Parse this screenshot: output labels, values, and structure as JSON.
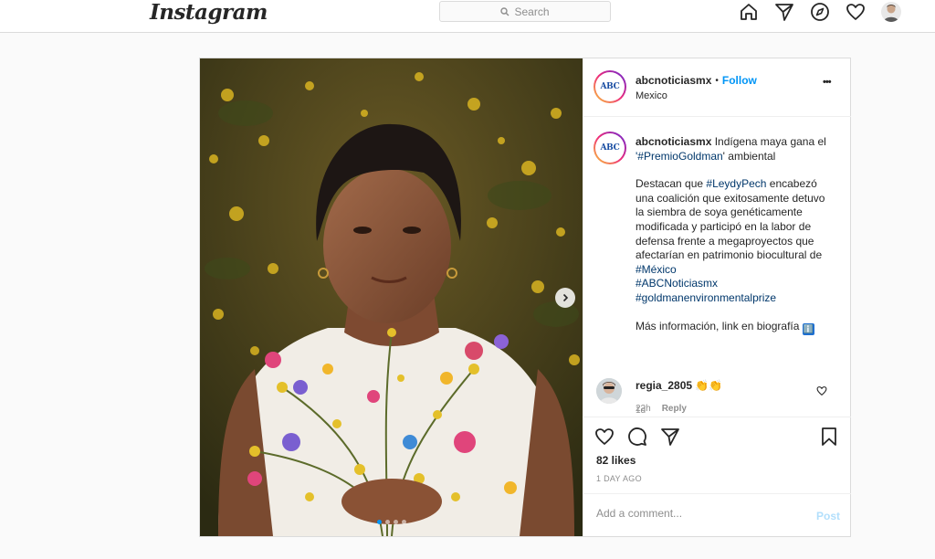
{
  "nav": {
    "logo": "Instagram",
    "search_placeholder": "Search"
  },
  "post": {
    "account": "abcnoticiasmx",
    "avatar_text": "ABC",
    "follow_label": "Follow",
    "separator": "•",
    "location": "Mexico",
    "more_label": "•••",
    "caption": {
      "username": "abcnoticiasmx",
      "line1": "Indígena maya gana el",
      "hashtag_quote_open": "'",
      "hashtag1": "#PremioGoldman",
      "line2_rest": "' ambiental",
      "p2_a": "Destacan que ",
      "hashtag2": "#LeydyPech",
      "p2_b": " encabezó una coalición que exitosamente detuvo la siembra de soya genéticamente modificada y participó en la labor de defensa frente a megaproyectos que afectarían en patrimonio biocultural de ",
      "hashtag3": "#México",
      "hashtag4": "#ABCNoticiasmx",
      "hashtag5": "#goldmanenvironmentalprize",
      "p3": "Más información, link en biografía",
      "p3_emoji": "ℹ️",
      "time_ago": "1d"
    },
    "comment": {
      "username": "regia_2805",
      "emoji": "👏👏",
      "time": "22h",
      "reply_label": "Reply"
    },
    "likes": "82 likes",
    "date": "1 DAY AGO",
    "add_comment_placeholder": "Add a comment...",
    "post_label": "Post"
  },
  "colors": {
    "link_blue": "#0095f6",
    "hashtag": "#00376b",
    "border": "#dbdbdb"
  }
}
